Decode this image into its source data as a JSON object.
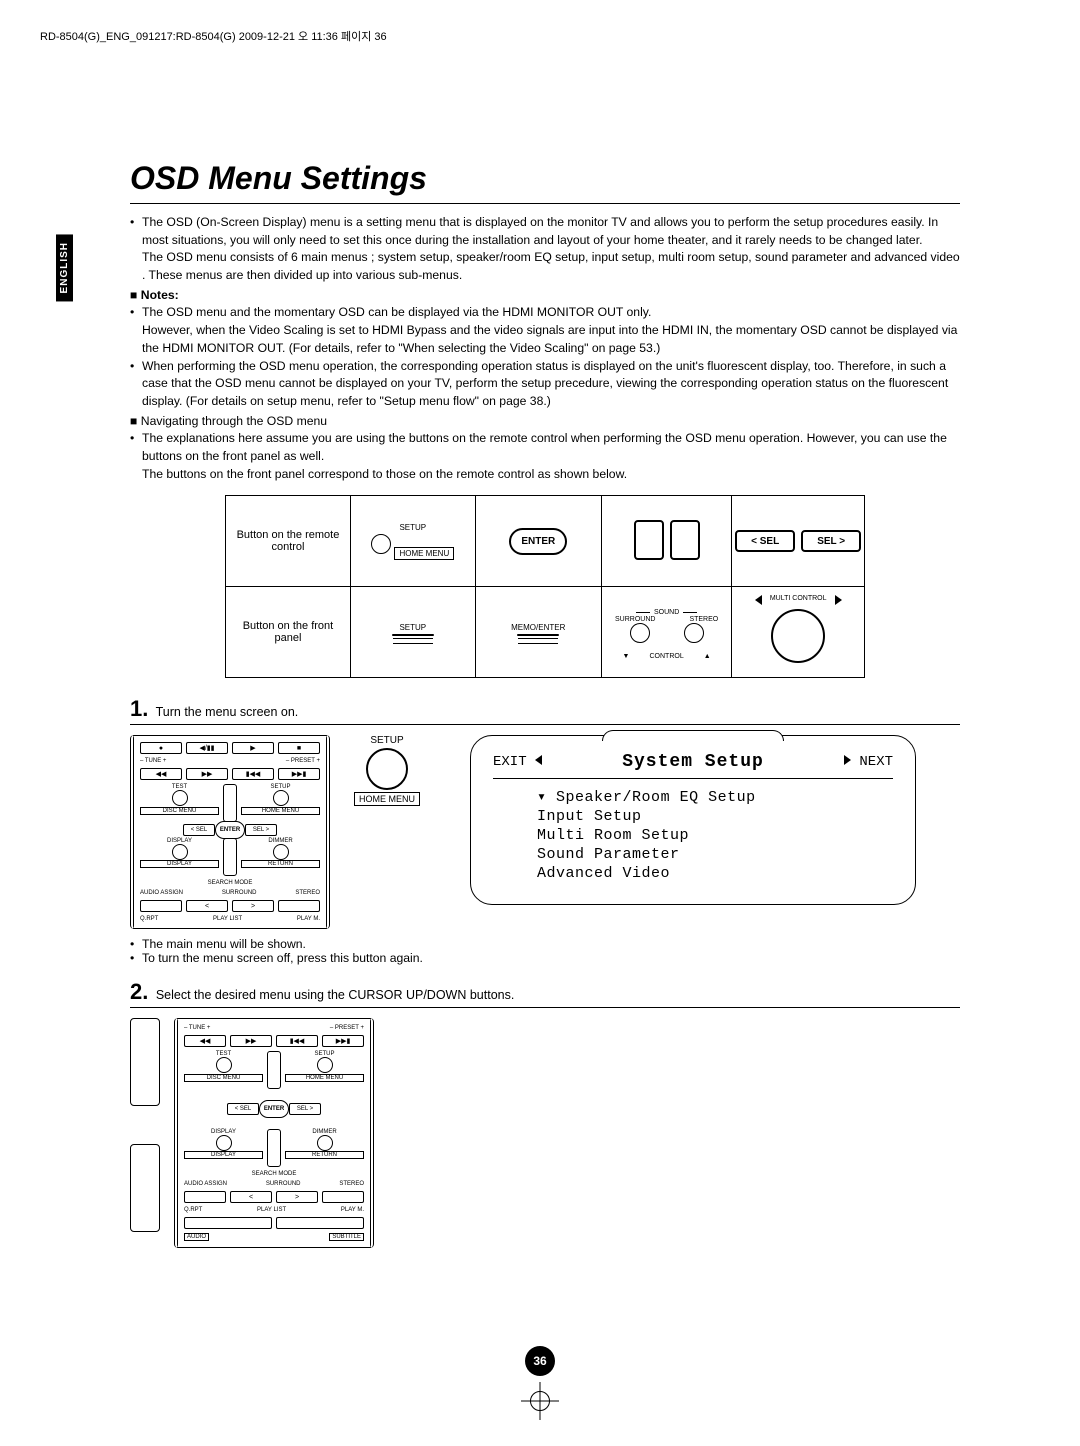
{
  "header_line": "RD-8504(G)_ENG_091217:RD-8504(G)  2009-12-21  오   11:36  페이지  36",
  "side_tab": "ENGLISH",
  "title": "OSD Menu Settings",
  "intro": {
    "p1": "The OSD (On-Screen Display) menu is a setting menu that is displayed on the monitor TV and allows you to perform the setup procedures easily. In most situations, you will only need to set this once during the installation and layout of your home theater, and it rarely needs to be changed later.",
    "p2": "The OSD menu consists of 6 main menus ; system setup, speaker/room EQ setup, input setup, multi room setup, sound parameter and advanced video . These menus are then divided up into various sub-menus."
  },
  "notes_label": "Notes:",
  "notes": {
    "n1a": "The OSD menu and the momentary OSD can be displayed via the HDMI MONITOR OUT only.",
    "n1b": "However, when the Video Scaling is set to HDMI Bypass and the video signals are input into the HDMI IN, the momentary OSD cannot be displayed via the HDMI MONITOR OUT. (For details, refer to \"When selecting the Video Scaling\" on page 53.)",
    "n2": "When performing the OSD menu operation, the corresponding operation status is displayed on the unit's fluorescent display, too. Therefore, in such a case that the OSD menu cannot be displayed on your TV, perform the setup precedure, viewing the corresponding operation status on the fluorescent display. (For details on setup menu, refer to \"Setup menu flow\" on page 38.)"
  },
  "nav_label": "Navigating through the OSD menu",
  "nav": {
    "p1": "The explanations here assume you are using the buttons on the remote control when performing the OSD menu operation. However, you can use the buttons on the front panel as well.",
    "p2": "The buttons on the front panel correspond to those on the remote control as shown below."
  },
  "button_table": {
    "row1_label": "Button on the remote control",
    "row2_label": "Button on the front panel",
    "setup": "SETUP",
    "home_menu": "HOME MENU",
    "enter": "ENTER",
    "sel_left": "< SEL",
    "sel_right": "SEL >",
    "fp_setup": "SETUP",
    "fp_memo": "MEMO/ENTER",
    "sound": "SOUND",
    "surround": "SURROUND",
    "stereo": "STEREO",
    "control": "CONTROL",
    "multi": "MULTI CONTROL"
  },
  "step1": {
    "num": "1.",
    "text": "Turn the menu screen on.",
    "callout_setup": "SETUP",
    "callout_home": "HOME MENU",
    "bullet1": "The main menu will be shown.",
    "bullet2": "To turn the menu screen off, press this button again."
  },
  "osd": {
    "exit": "EXIT",
    "next": "NEXT",
    "title": "System Setup",
    "items": [
      "Speaker/Room EQ Setup",
      "Input Setup",
      "Multi Room Setup",
      "Sound Parameter",
      "Advanced Video"
    ]
  },
  "step2": {
    "num": "2.",
    "text": "Select the desired menu using the CURSOR UP/DOWN buttons."
  },
  "remote_labels": {
    "tune_m": "– TUNE +",
    "preset_m": "– PRESET +",
    "test": "TEST",
    "setup": "SETUP",
    "disc_menu": "DISC MENU",
    "home_menu": "HOME MENU",
    "sel_l": "< SEL",
    "sel_r": "SEL >",
    "enter": "ENTER",
    "display": "DISPLAY",
    "dimmer": "DIMMER",
    "return": "RETURN",
    "search": "SEARCH MODE",
    "audio_assign": "AUDIO ASSIGN",
    "surround": "SURROUND",
    "stereo": "STEREO",
    "qrpt": "Q.RPT",
    "playlist": "PLAY LIST",
    "playm": "PLAY M.",
    "audio": "AUDIO",
    "subtitle": "SUBTITLE"
  },
  "page_number": "36"
}
